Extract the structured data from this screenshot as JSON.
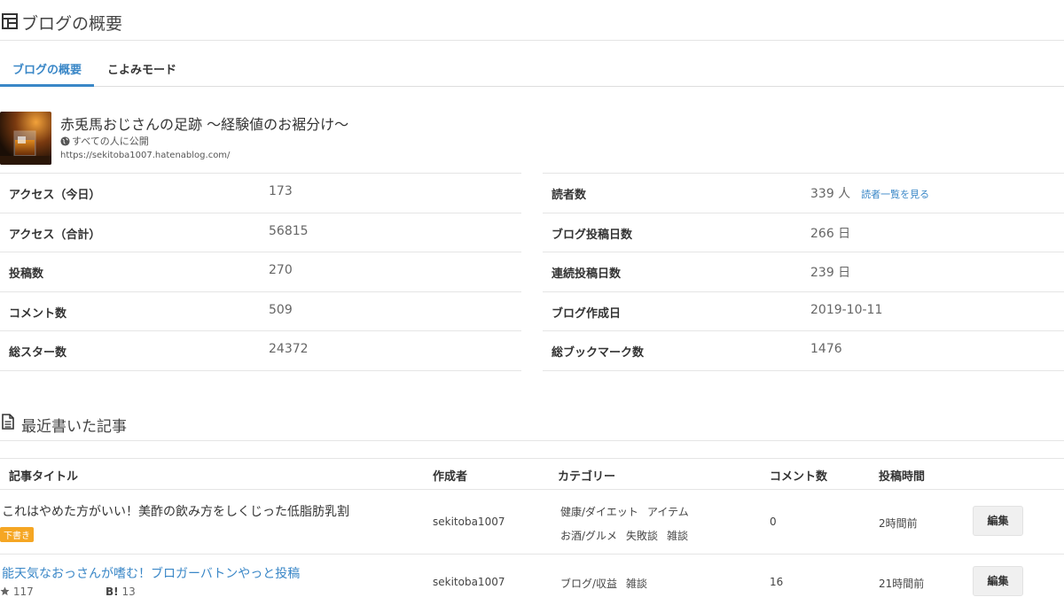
{
  "header": {
    "title": "ブログの概要"
  },
  "tabs": [
    {
      "label": "ブログの概要",
      "active": true
    },
    {
      "label": "こよみモード",
      "active": false
    }
  ],
  "blog": {
    "name": "赤兎馬おじさんの足跡 ～経験値のお裾分け～",
    "visibility": "すべての人に公開",
    "url": "https://sekitoba1007.hatenablog.com/"
  },
  "stats_left": [
    {
      "label": "アクセス（今日）",
      "value": "173"
    },
    {
      "label": "アクセス（合計）",
      "value": "56815"
    },
    {
      "label": "投稿数",
      "value": "270"
    },
    {
      "label": "コメント数",
      "value": "509"
    },
    {
      "label": "総スター数",
      "value": "24372"
    }
  ],
  "stats_right": [
    {
      "label": "読者数",
      "value": "339 人",
      "link": "読者一覧を見る"
    },
    {
      "label": "ブログ投稿日数",
      "value": "266 日"
    },
    {
      "label": "連続投稿日数",
      "value": "239 日"
    },
    {
      "label": "ブログ作成日",
      "value": "2019-10-11"
    },
    {
      "label": "総ブックマーク数",
      "value": "1476"
    }
  ],
  "recent": {
    "title": "最近書いた記事",
    "columns": {
      "title": "記事タイトル",
      "author": "作成者",
      "category": "カテゴリー",
      "comments": "コメント数",
      "time": "投稿時間"
    },
    "rows": [
      {
        "title": "これはやめた方がいい！美酢の飲み方をしくじった低脂肪乳割",
        "badge": "下書き",
        "author": "sekitoba1007",
        "categories_line1": [
          "健康/ダイエット",
          "アイテム"
        ],
        "categories_line2": [
          "お酒/グルメ",
          "失敗談",
          "雑談"
        ],
        "comments": "0",
        "time": "2時間前",
        "edit": "編集"
      },
      {
        "title": "能天気なおっさんが嗜む！ブロガーバトンやっと投稿",
        "stars": "117",
        "bookmark_icon": "B!",
        "bookmarks": "13",
        "author": "sekitoba1007",
        "categories_line1": [
          "ブログ/収益",
          "雑談"
        ],
        "comments": "16",
        "time": "21時間前",
        "edit": "編集"
      }
    ]
  },
  "colors": {
    "accent": "#3a87c7",
    "draft": "#f5a623"
  }
}
